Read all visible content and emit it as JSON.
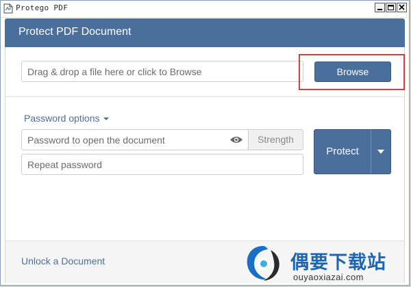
{
  "window": {
    "title": "Protego PDF"
  },
  "header": {
    "title": "Protect PDF Document"
  },
  "file": {
    "placeholder": "Drag & drop a file here or click to Browse",
    "browse_label": "Browse"
  },
  "password": {
    "options_label": "Password options",
    "open_placeholder": "Password to open the document",
    "strength_label": "Strength",
    "repeat_placeholder": "Repeat password"
  },
  "actions": {
    "protect_label": "Protect"
  },
  "footer": {
    "unlock_label": "Unlock a Document"
  },
  "watermark": {
    "text": "偶要下载站",
    "url": "ouyaoxiazai.com"
  },
  "icons": {
    "app": "pdf-file-icon",
    "eye": "eye-icon",
    "options_caret": "caret-down-icon",
    "protect_dropdown": "caret-down-icon",
    "minimize": "minimize-icon",
    "maximize": "maximize-icon",
    "close": "close-icon"
  },
  "colors": {
    "accent": "#4a6f9c",
    "highlight_border": "#d93c3c",
    "watermark": "#1d65b3"
  }
}
